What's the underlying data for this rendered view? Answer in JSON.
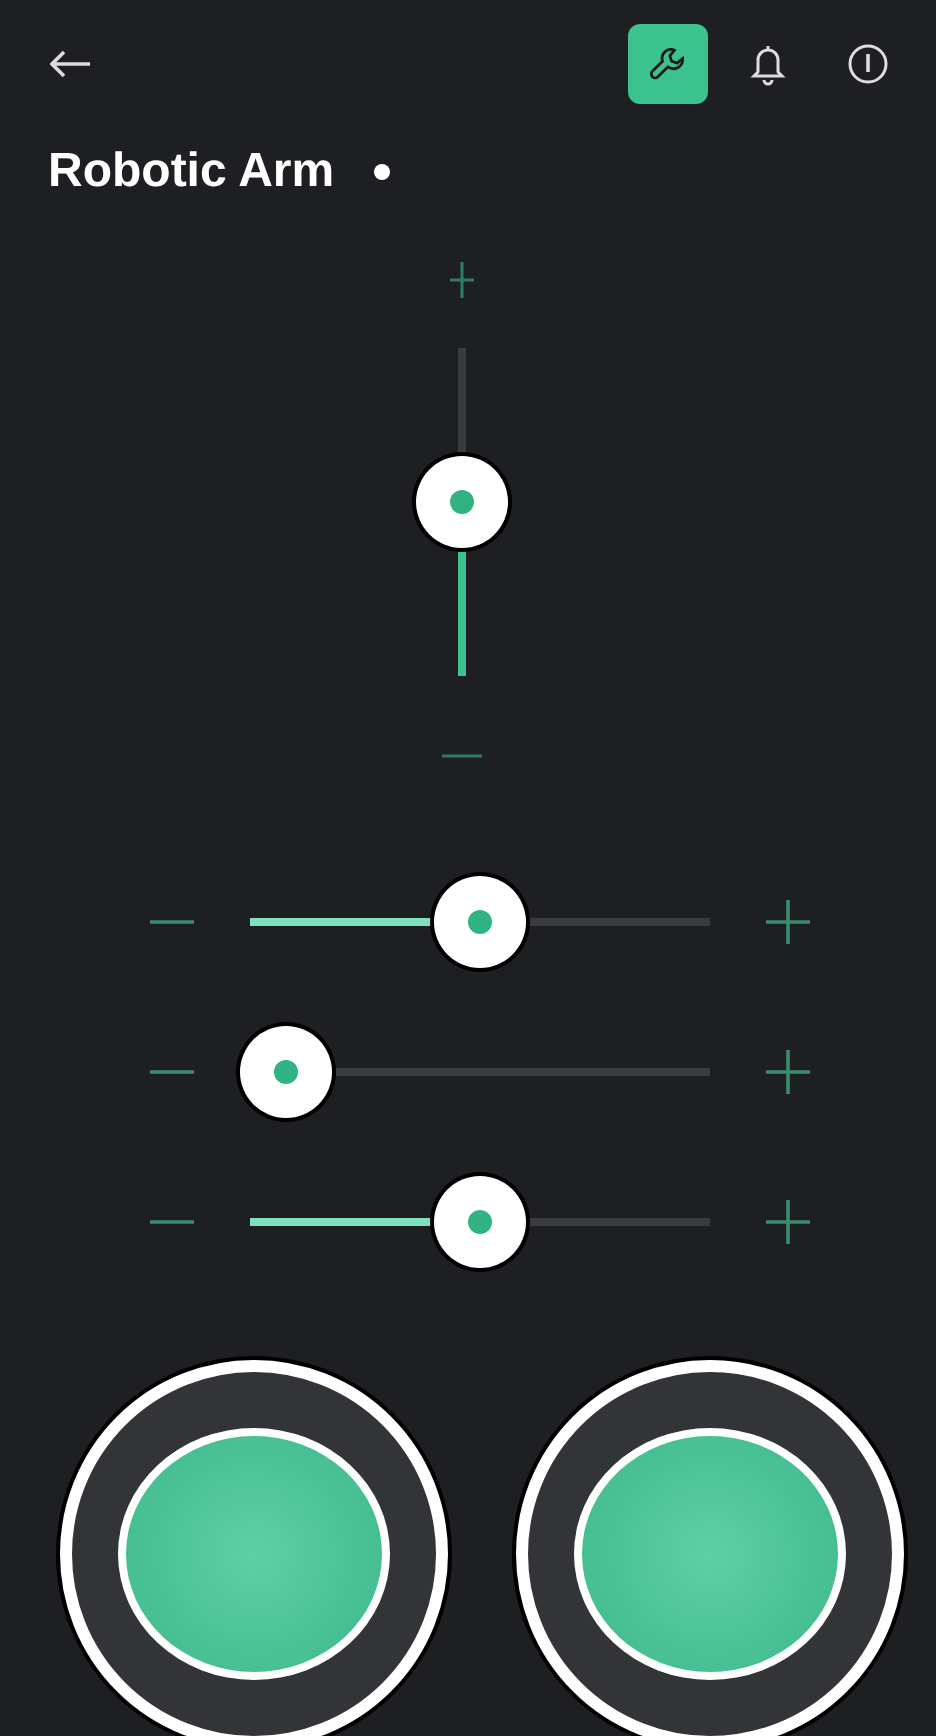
{
  "toolbar": [
    {
      "kind": "wrench",
      "selected": true
    },
    {
      "kind": "bell",
      "selected": false
    },
    {
      "kind": "info",
      "selected": false
    }
  ],
  "device": {
    "title": "Robotic Arm",
    "online": true
  },
  "vertical_slider": {
    "level": 0.53
  },
  "sliders": [
    {
      "level": 0.5
    },
    {
      "level": 0.08
    },
    {
      "level": 0.5
    }
  ]
}
